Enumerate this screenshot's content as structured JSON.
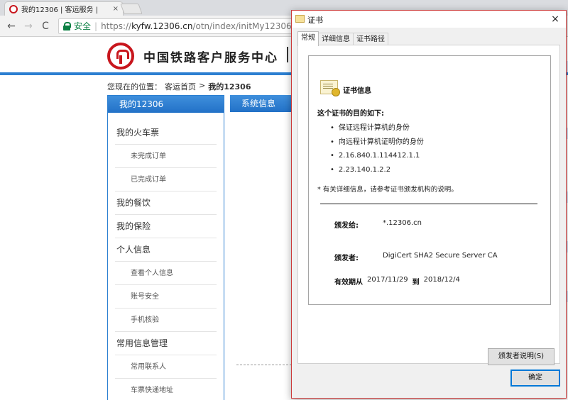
{
  "browser": {
    "tab_title": "我的12306 | 客运服务 | ",
    "tab_close": "×",
    "back_icon": "←",
    "forward_icon": "→",
    "reload_icon": "C",
    "secure_label": "安全",
    "url_scheme": "https://",
    "url_host": "kyfw.12306.cn",
    "url_path": "/otn/index/initMy12306"
  },
  "site": {
    "title": "中国铁路客户服务中心",
    "breadcrumb": {
      "prefix": "您现在的位置：",
      "home": "客运首页",
      "sep": ">",
      "current": "我的12306"
    }
  },
  "sidebar": {
    "header": "我的12306",
    "items": [
      {
        "label": "我的火车票",
        "kind": "cat"
      },
      {
        "label": "未完成订单",
        "kind": "sub"
      },
      {
        "label": "已完成订单",
        "kind": "sub"
      },
      {
        "label": "我的餐饮",
        "kind": "cat"
      },
      {
        "label": "我的保险",
        "kind": "cat"
      },
      {
        "label": "个人信息",
        "kind": "cat"
      },
      {
        "label": "查看个人信息",
        "kind": "sub"
      },
      {
        "label": "账号安全",
        "kind": "sub"
      },
      {
        "label": "手机核验",
        "kind": "sub"
      },
      {
        "label": "常用信息管理",
        "kind": "cat"
      },
      {
        "label": "常用联系人",
        "kind": "sub"
      },
      {
        "label": "车票快递地址",
        "kind": "sub"
      }
    ]
  },
  "main": {
    "sysinfo_header": "系统信息"
  },
  "cert_dialog": {
    "title": "证书",
    "close": "×",
    "tabs": [
      "常规",
      "详细信息",
      "证书路径"
    ],
    "heading": "证书信息",
    "purpose_label": "这个证书的目的如下:",
    "purposes": [
      "保证远程计算机的身份",
      "向远程计算机证明你的身份",
      "2.16.840.1.114412.1.1",
      "2.23.140.1.2.2"
    ],
    "note": "* 有关详细信息，请参考证书颁发机构的说明。",
    "issued_to_label": "颁发给:",
    "issued_to": "*.12306.cn",
    "issued_by_label": "颁发者:",
    "issued_by": "DigiCert SHA2 Secure Server CA",
    "valid_from_label": "有效期从",
    "valid_from": "2017/11/29",
    "valid_to_label": "到",
    "valid_to": "2018/12/4",
    "issuer_statement_button": "颁发者说明(S)",
    "ok_button": "确定"
  }
}
